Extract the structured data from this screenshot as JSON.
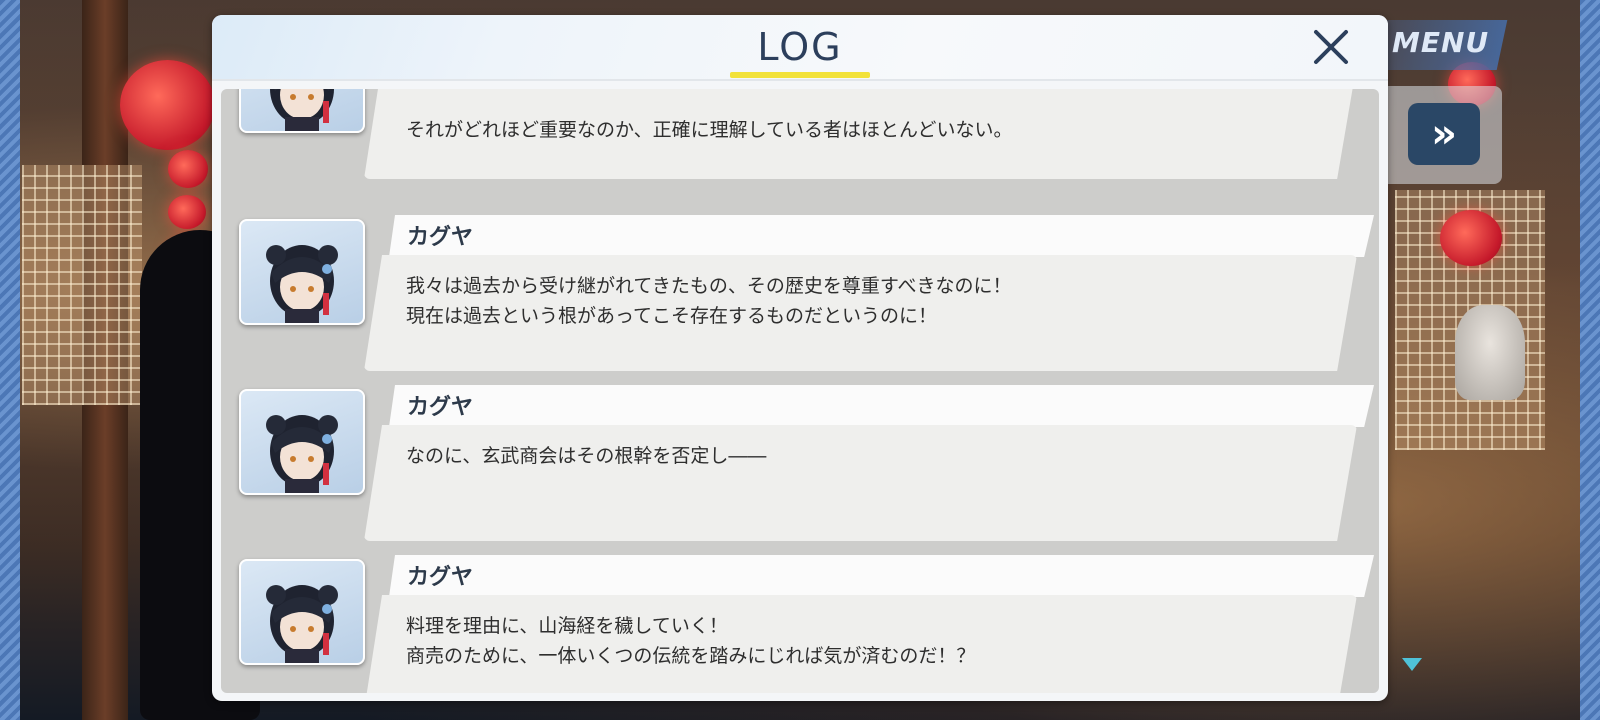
{
  "menu": {
    "label": "MENU"
  },
  "controls": {
    "skip_glyph": "»"
  },
  "log": {
    "title": "LOG",
    "close_glyph": "×",
    "entries": [
      {
        "speaker": "",
        "lines": [
          "それがどれほど重要なのか、正確に理解している者はほとんどいない。"
        ]
      },
      {
        "speaker": "カグヤ",
        "lines": [
          "我々は過去から受け継がれてきたもの、その歴史を尊重すべきなのに！",
          "現在は過去という根があってこそ存在するものだというのに！"
        ]
      },
      {
        "speaker": "カグヤ",
        "lines": [
          "なのに、玄武商会はその根幹を否定し――"
        ]
      },
      {
        "speaker": "カグヤ",
        "lines": [
          "料理を理由に、山海経を穢していく！",
          "商売のために、一体いくつの伝統を踏みにじれば気が済むのだ！？"
        ]
      }
    ]
  },
  "colors": {
    "title_text": "#2c3f5c",
    "title_underline": "#f2e23a",
    "menu_accent": "#4a6ea8",
    "skip_button": "#2a4766",
    "next_indicator": "#4fc2d8"
  }
}
